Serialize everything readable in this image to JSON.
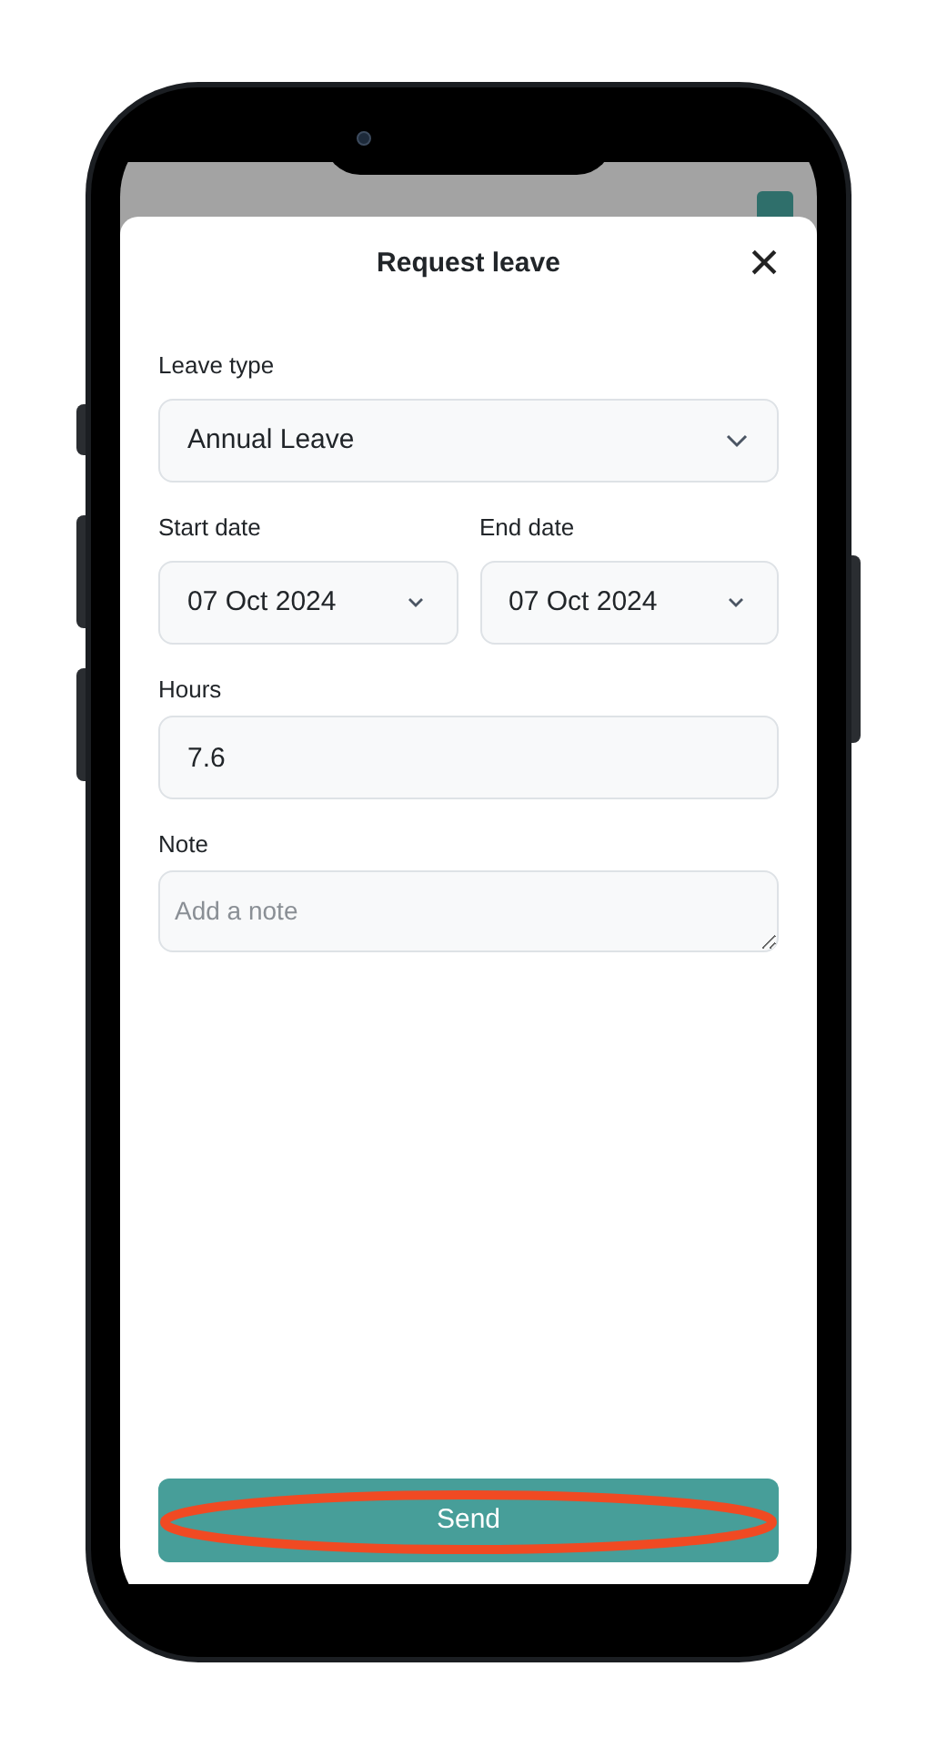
{
  "sheet": {
    "title": "Request leave",
    "close": "×"
  },
  "fields": [
    {
      "kind": "select",
      "label": "Leave type",
      "value": "Annual Leave"
    },
    {
      "kind": "date_pair",
      "items": [
        {
          "label": "Start date",
          "value": "07 Oct 2024"
        },
        {
          "label": "End date",
          "value": "07 Oct 2024"
        }
      ]
    },
    {
      "kind": "input",
      "label": "Hours",
      "value": "7.6"
    },
    {
      "kind": "textarea",
      "label": "Note",
      "placeholder": "Add a note"
    }
  ],
  "send_button": {
    "label": "Send",
    "highlighted": true
  }
}
